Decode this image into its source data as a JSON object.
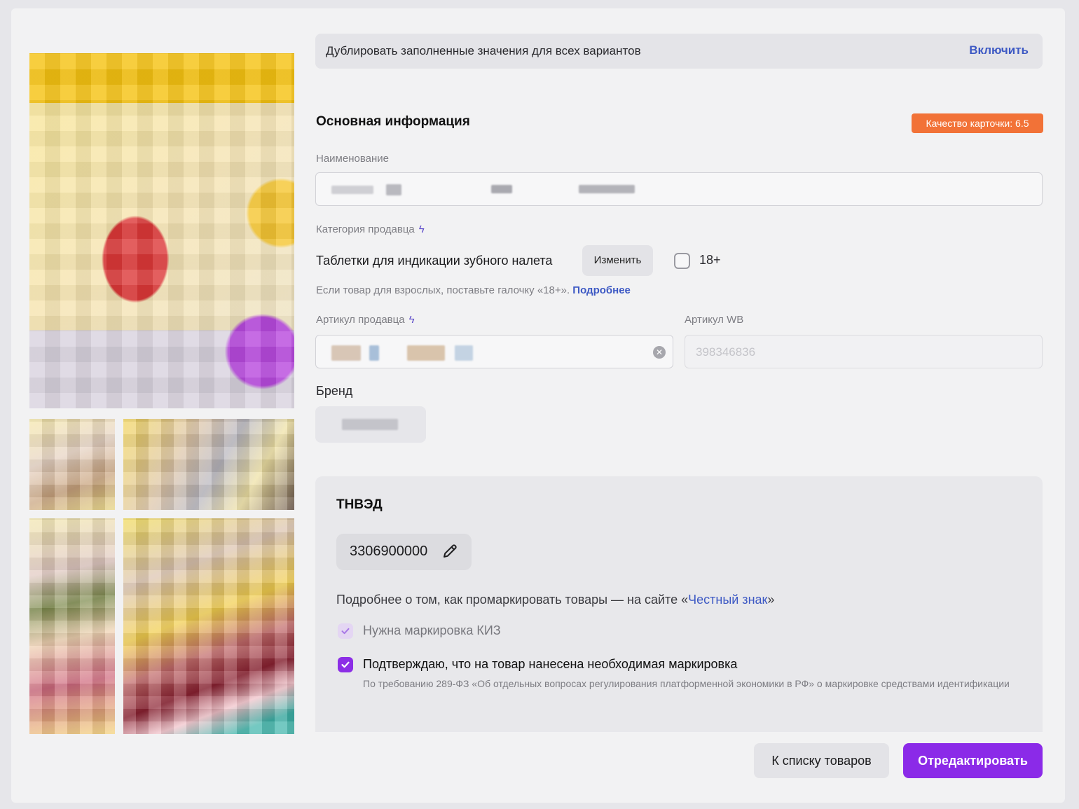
{
  "duplicate_bar": {
    "text": "Дублировать заполненные значения для всех вариантов",
    "action": "Включить"
  },
  "main_info": {
    "title": "Основная информация",
    "quality_badge": "Качество карточки: 6.5",
    "name_label": "Наименование",
    "category_label": "Категория продавца",
    "category_value": "Таблетки для индикации зубного налета",
    "change_button": "Изменить",
    "adult_label": "18+",
    "adult_hint": "Если товар для взрослых, поставьте галочку «18+».",
    "adult_hint_link": "Подробнее",
    "seller_sku_label": "Артикул продавца",
    "wb_sku_label": "Артикул WB",
    "wb_sku_value": "398346836",
    "brand_label": "Бренд"
  },
  "tnved": {
    "title": "ТНВЭД",
    "code": "3306900000",
    "info_prefix": "Подробнее о том, как промаркировать товары — на сайте «",
    "info_link": "Честный знак",
    "info_suffix": "»",
    "kiz_label": "Нужна маркировка КИЗ",
    "kiz_checked": true,
    "confirm_label": "Подтверждаю, что на товар нанесена необходимая маркировка",
    "confirm_checked": true,
    "confirm_note": "По требованию 289-ФЗ «Об отдельных вопросах регулирования платформенной экономики в РФ» о маркировке средствами идентификации"
  },
  "footer": {
    "back_button": "К списку товаров",
    "edit_button": "Отредактировать"
  },
  "colors": {
    "accent": "#8b2ae8",
    "link": "#3d59c4",
    "quality_badge": "#f27237"
  },
  "icons": {
    "bolt": "bolt-icon",
    "clear": "clear-icon",
    "pencil": "pencil-icon",
    "check": "check-icon"
  }
}
